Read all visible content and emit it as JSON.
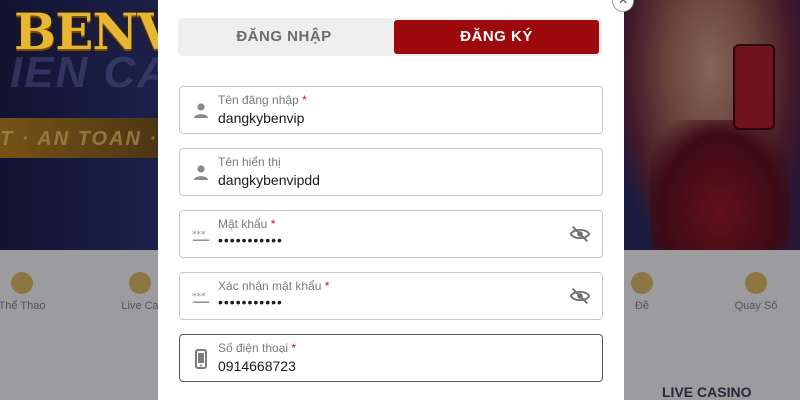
{
  "brand": {
    "logo_text": "BENVIP"
  },
  "background": {
    "banner_script": "IEN CA",
    "banner_ribbon": "T · AN TOAN ·",
    "menu_items": [
      {
        "label": "Thể Thao"
      },
      {
        "label": "Live Ca"
      },
      {
        "label": "Đề"
      },
      {
        "label": "Quay Số"
      }
    ],
    "live_casino_heading": "LIVE CASINO"
  },
  "modal": {
    "close_label": "×",
    "tabs": [
      {
        "label": "ĐĂNG NHẬP",
        "active": false
      },
      {
        "label": "ĐĂNG KÝ",
        "active": true
      }
    ],
    "fields": {
      "username": {
        "label": "Tên đăng nhập",
        "required": "*",
        "value": "dangkybenvip",
        "icon": "user-icon"
      },
      "display_name": {
        "label": "Tên hiển thị",
        "required": "",
        "value": "dangkybenvipdd",
        "icon": "user-icon"
      },
      "password": {
        "label": "Mật khẩu",
        "required": "*",
        "value": "•••••••••••",
        "icon": "password-icon"
      },
      "confirm_password": {
        "label": "Xác nhận mật khẩu",
        "required": "*",
        "value": "•••••••••••",
        "icon": "password-icon"
      },
      "phone": {
        "label": "Số điện thoại",
        "required": "*",
        "value": "0914668723",
        "icon": "phone-icon"
      }
    }
  },
  "colors": {
    "accent_red": "#9d0a0e",
    "required_red": "#c8102e",
    "logo_gold": "#e7b734"
  }
}
